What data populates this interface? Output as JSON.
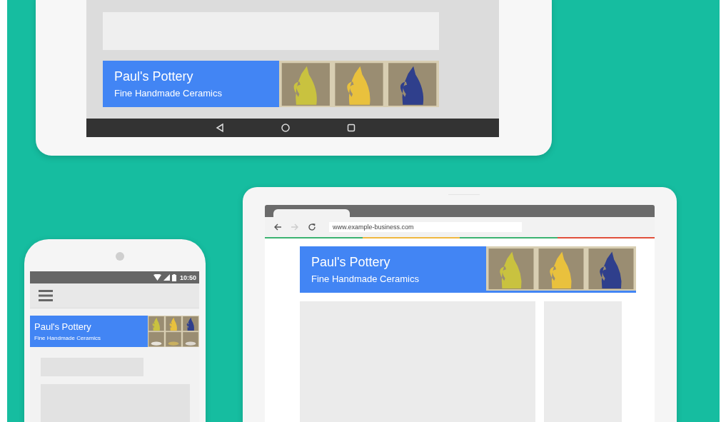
{
  "tablet": {
    "banner": {
      "title": "Paul's Pottery",
      "subtitle": "Fine Handmade Ceramics"
    },
    "nav_buttons": [
      {
        "kind": "back"
      },
      {
        "kind": "home"
      },
      {
        "kind": "recents"
      }
    ]
  },
  "laptop": {
    "browser": {
      "nav_buttons": [
        {
          "kind": "back",
          "disabled": false
        },
        {
          "kind": "forward",
          "disabled": true
        },
        {
          "kind": "reload",
          "disabled": false
        }
      ],
      "url": "www.example-business.com"
    },
    "banner": {
      "title": "Paul's Pottery",
      "subtitle": "Fine Handmade Ceramics"
    }
  },
  "phone": {
    "status_bar": {
      "time": "10:50"
    },
    "banner": {
      "title": "Paul's Pottery",
      "subtitle": "Fine Handmade Ceramics"
    }
  }
}
